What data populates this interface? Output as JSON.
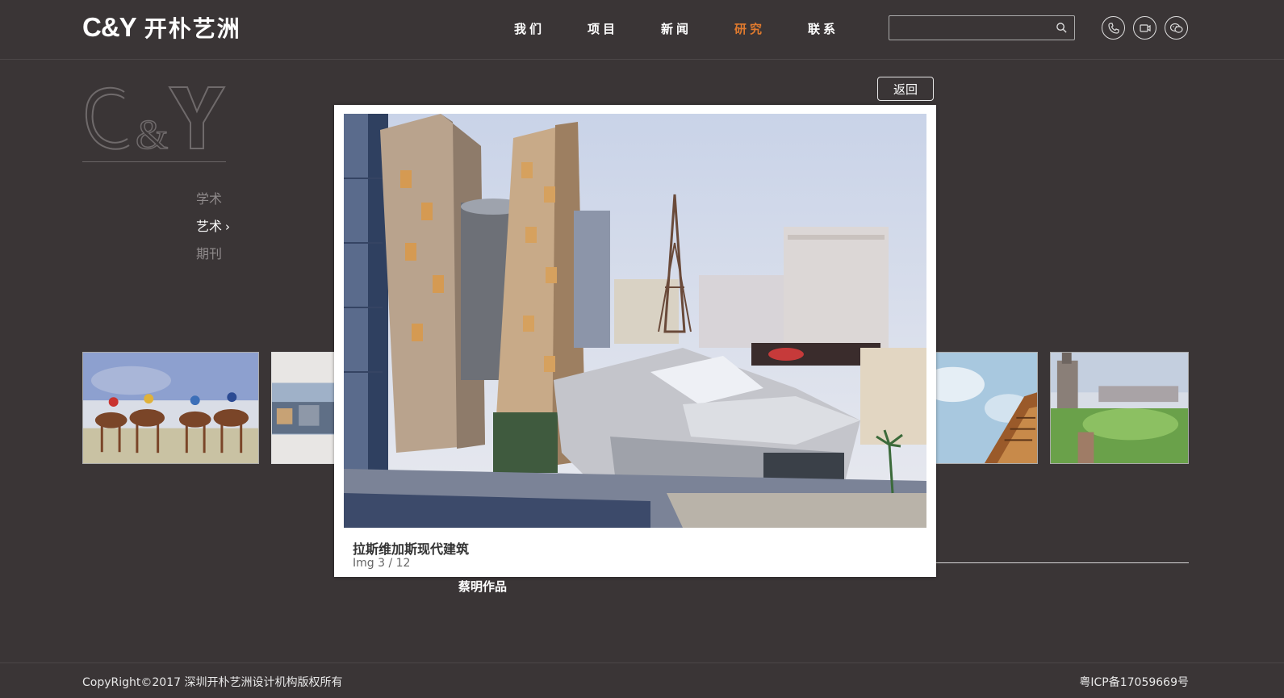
{
  "header": {
    "logo_mark": "C&Y",
    "logo_text": "开朴艺洲",
    "nav": [
      {
        "label": "我们",
        "active": false
      },
      {
        "label": "项目",
        "active": false
      },
      {
        "label": "新闻",
        "active": false
      },
      {
        "label": "研究",
        "active": true
      },
      {
        "label": "联系",
        "active": false
      }
    ],
    "search": {
      "value": "",
      "placeholder": ""
    },
    "social_icons": [
      "phone-icon",
      "video-icon",
      "wechat-icon"
    ]
  },
  "sidebar": {
    "big_logo": "C&Y",
    "items": [
      {
        "label": "学术",
        "active": false
      },
      {
        "label": "艺术",
        "active": true
      },
      {
        "label": "期刊",
        "active": false
      }
    ]
  },
  "back_label": "返回",
  "lightbox": {
    "title": "拉斯维加斯现代建筑",
    "counter": "Img 3 / 12"
  },
  "album_title": "蔡明作品",
  "footer": {
    "copyright": "CopyRight©2017 深圳开朴艺洲设计机构版权所有",
    "icp": "粤ICP备17059669号"
  },
  "colors": {
    "background": "#3a3536",
    "accent": "#e07a2e",
    "lightbox_bg": "#ffffff"
  }
}
